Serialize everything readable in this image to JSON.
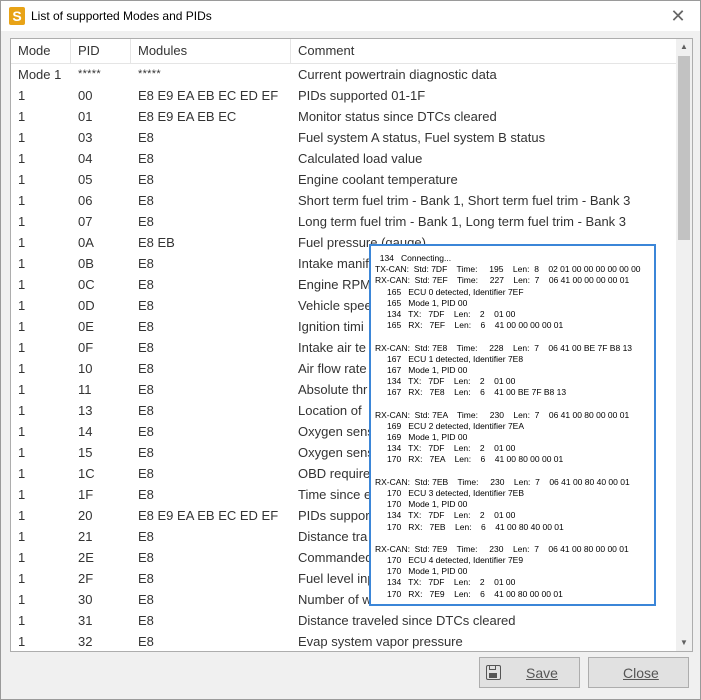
{
  "window": {
    "title": "List of supported Modes and PIDs",
    "app_icon_letter": "S",
    "close_glyph": "✕"
  },
  "columns": {
    "mode": "Mode",
    "pid": "PID",
    "modules": "Modules",
    "comment": "Comment"
  },
  "rows": [
    {
      "mode": "Mode 1",
      "pid": "*****",
      "modules": "*****",
      "comment": "Current powertrain diagnostic data"
    },
    {
      "mode": "1",
      "pid": "00",
      "modules": "E8 E9 EA EB EC ED EF",
      "comment": "PIDs supported 01-1F"
    },
    {
      "mode": "1",
      "pid": "01",
      "modules": "E8 E9 EA EB EC",
      "comment": "Monitor status since DTCs cleared"
    },
    {
      "mode": "1",
      "pid": "03",
      "modules": "E8",
      "comment": "Fuel system A status, Fuel system B status"
    },
    {
      "mode": "1",
      "pid": "04",
      "modules": "E8",
      "comment": "Calculated load value"
    },
    {
      "mode": "1",
      "pid": "05",
      "modules": "E8",
      "comment": "Engine coolant temperature"
    },
    {
      "mode": "1",
      "pid": "06",
      "modules": "E8",
      "comment": "Short term fuel trim - Bank 1, Short term fuel trim - Bank 3"
    },
    {
      "mode": "1",
      "pid": "07",
      "modules": "E8",
      "comment": "Long term fuel trim - Bank 1, Long term fuel trim - Bank 3"
    },
    {
      "mode": "1",
      "pid": "0A",
      "modules": "E8 EB",
      "comment": "Fuel pressure (gauge)"
    },
    {
      "mode": "1",
      "pid": "0B",
      "modules": "E8",
      "comment": "Intake manif"
    },
    {
      "mode": "1",
      "pid": "0C",
      "modules": "E8",
      "comment": "Engine RPM"
    },
    {
      "mode": "1",
      "pid": "0D",
      "modules": "E8",
      "comment": "Vehicle spee"
    },
    {
      "mode": "1",
      "pid": "0E",
      "modules": "E8",
      "comment": "Ignition timi"
    },
    {
      "mode": "1",
      "pid": "0F",
      "modules": "E8",
      "comment": "Intake air te"
    },
    {
      "mode": "1",
      "pid": "10",
      "modules": "E8",
      "comment": "Air flow rate"
    },
    {
      "mode": "1",
      "pid": "11",
      "modules": "E8",
      "comment": "Absolute thr"
    },
    {
      "mode": "1",
      "pid": "13",
      "modules": "E8",
      "comment": "Location of"
    },
    {
      "mode": "1",
      "pid": "14",
      "modules": "E8",
      "comment": "Oxygen sens"
    },
    {
      "mode": "1",
      "pid": "15",
      "modules": "E8",
      "comment": "Oxygen sens"
    },
    {
      "mode": "1",
      "pid": "1C",
      "modules": "E8",
      "comment": "OBD require"
    },
    {
      "mode": "1",
      "pid": "1F",
      "modules": "E8",
      "comment": "Time since e"
    },
    {
      "mode": "1",
      "pid": "20",
      "modules": "E8 E9 EA EB EC ED EF",
      "comment": "PIDs suppor"
    },
    {
      "mode": "1",
      "pid": "21",
      "modules": "E8",
      "comment": "Distance tra"
    },
    {
      "mode": "1",
      "pid": "2E",
      "modules": "E8",
      "comment": "Commanded"
    },
    {
      "mode": "1",
      "pid": "2F",
      "modules": "E8",
      "comment": "Fuel level inp"
    },
    {
      "mode": "1",
      "pid": "30",
      "modules": "E8",
      "comment": "Number of w"
    },
    {
      "mode": "1",
      "pid": "31",
      "modules": "E8",
      "comment": "Distance traveled since DTCs cleared"
    },
    {
      "mode": "1",
      "pid": "32",
      "modules": "E8",
      "comment": "Evap system vapor pressure"
    }
  ],
  "log": [
    {
      "text": "  134   Connecting...",
      "indent": false
    },
    {
      "text": "TX-CAN:  Std: 7DF    Time:     195    Len:  8    02 01 00 00 00 00 00 00",
      "indent": false
    },
    {
      "text": "RX-CAN:  Std: 7EF    Time:     227    Len:  7    06 41 00 00 00 00 01",
      "indent": false
    },
    {
      "text": "165   ECU 0 detected, Identifier 7EF",
      "indent": true
    },
    {
      "text": "165   Mode 1, PID 00",
      "indent": true
    },
    {
      "text": "134   TX:   7DF    Len:    2    01 00",
      "indent": true
    },
    {
      "text": "165   RX:   7EF    Len:    6    41 00 00 00 00 01",
      "indent": true
    },
    {
      "text": "",
      "indent": false
    },
    {
      "text": "RX-CAN:  Std: 7E8    Time:     228    Len:  7    06 41 00 BE 7F B8 13",
      "indent": false
    },
    {
      "text": "167   ECU 1 detected, Identifier 7E8",
      "indent": true
    },
    {
      "text": "167   Mode 1, PID 00",
      "indent": true
    },
    {
      "text": "134   TX:   7DF    Len:    2    01 00",
      "indent": true
    },
    {
      "text": "167   RX:   7E8    Len:    6    41 00 BE 7F B8 13",
      "indent": true
    },
    {
      "text": "",
      "indent": false
    },
    {
      "text": "RX-CAN:  Std: 7EA    Time:     230    Len:  7    06 41 00 80 00 00 01",
      "indent": false
    },
    {
      "text": "169   ECU 2 detected, Identifier 7EA",
      "indent": true
    },
    {
      "text": "169   Mode 1, PID 00",
      "indent": true
    },
    {
      "text": "134   TX:   7DF    Len:    2    01 00",
      "indent": true
    },
    {
      "text": "170   RX:   7EA    Len:    6    41 00 80 00 00 01",
      "indent": true
    },
    {
      "text": "",
      "indent": false
    },
    {
      "text": "RX-CAN:  Std: 7EB    Time:     230    Len:  7    06 41 00 80 40 00 01",
      "indent": false
    },
    {
      "text": "170   ECU 3 detected, Identifier 7EB",
      "indent": true
    },
    {
      "text": "170   Mode 1, PID 00",
      "indent": true
    },
    {
      "text": "134   TX:   7DF    Len:    2    01 00",
      "indent": true
    },
    {
      "text": "170   RX:   7EB    Len:    6    41 00 80 40 00 01",
      "indent": true
    },
    {
      "text": "",
      "indent": false
    },
    {
      "text": "RX-CAN:  Std: 7E9    Time:     230    Len:  7    06 41 00 80 00 00 01",
      "indent": false
    },
    {
      "text": "170   ECU 4 detected, Identifier 7E9",
      "indent": true
    },
    {
      "text": "170   Mode 1, PID 00",
      "indent": true
    },
    {
      "text": "134   TX:   7DF    Len:    2    01 00",
      "indent": true
    },
    {
      "text": "170   RX:   7E9    Len:    6    41 00 80 00 00 01",
      "indent": true
    }
  ],
  "scrollbar": {
    "up_glyph": "▲",
    "down_glyph": "▼"
  },
  "buttons": {
    "save": "Save",
    "close": "Close"
  }
}
